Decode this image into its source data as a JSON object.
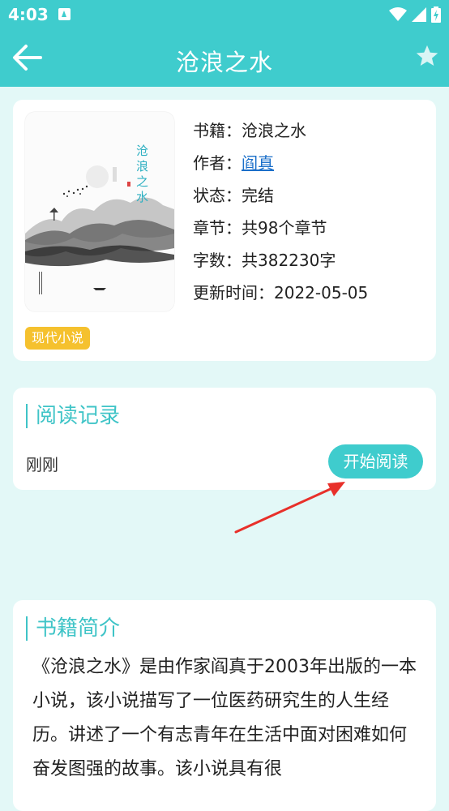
{
  "status_bar": {
    "time": "4:03"
  },
  "app_bar": {
    "title": "沧浪之水"
  },
  "book": {
    "cover_title": "沧浪之水",
    "rows": [
      {
        "label": "书籍：",
        "value": "沧浪之水"
      },
      {
        "label": "作者：",
        "value": "阎真"
      },
      {
        "label": "状态：",
        "value": "完结"
      },
      {
        "label": "章节：",
        "value": "共98个章节"
      },
      {
        "label": "字数：",
        "value": "共382230字"
      },
      {
        "label": "更新时间：",
        "value": "2022-05-05"
      }
    ],
    "genre_tag": "现代小说"
  },
  "record": {
    "title": "阅读记录",
    "time": "刚刚",
    "start_button": "开始阅读"
  },
  "intro": {
    "title": "书籍简介",
    "text": "《沧浪之水》是由作家阎真于2003年出版的一本小说，该小说描写了一位医药研究生的人生经历。讲述了一个有志青年在生活中面对困难如何奋发图强的故事。该小说具有很"
  },
  "colors": {
    "accent": "#3fcccd",
    "tag": "#f5c12e",
    "link": "#1b6fc9",
    "annotation_arrow": "#e8302a"
  },
  "icons": {
    "back": "arrow-left-icon",
    "favorite": "star-icon",
    "wifi": "wifi-icon",
    "signal": "signal-icon",
    "battery": "battery-icon",
    "notification": "notification-icon"
  }
}
